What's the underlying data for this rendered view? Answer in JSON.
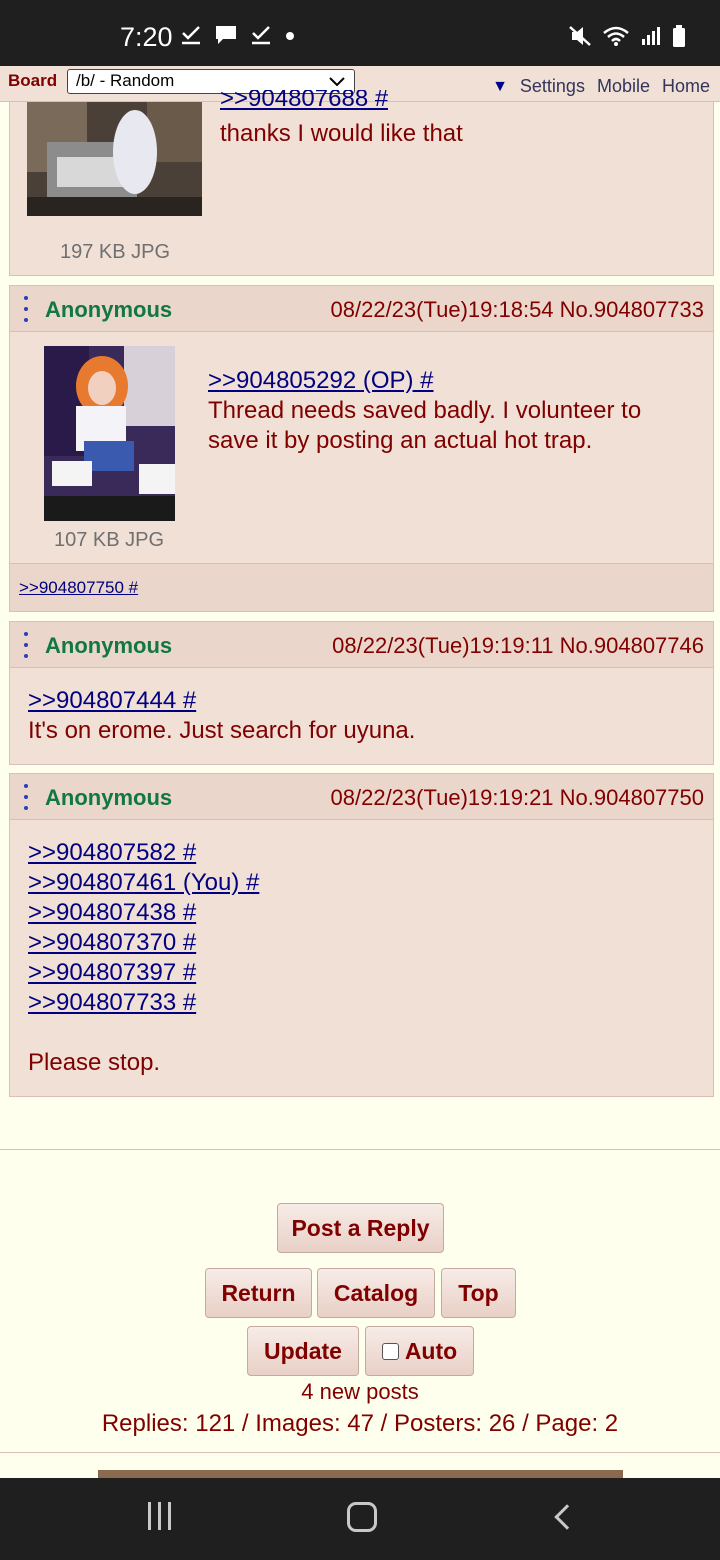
{
  "status_bar": {
    "time": "7:20",
    "left_icons": [
      "download-check-icon",
      "chat-bubble-icon",
      "check-icon",
      "dot-icon"
    ],
    "right_icons": [
      "mute-icon",
      "wifi-icon",
      "signal-icon",
      "battery-icon"
    ]
  },
  "board_bar": {
    "board_label": "Board",
    "board_value": "/b/ - Random",
    "settings": "Settings",
    "mobile": "Mobile",
    "home": "Home"
  },
  "posts": [
    {
      "partial": true,
      "quote": ">>904807688 #",
      "text": "thanks I would like that",
      "file_info": "197 KB JPG"
    },
    {
      "name": "Anonymous",
      "date_no": "08/22/23(Tue)19:18:54 No.904807733",
      "quotes": [
        ">>904805292 (OP) #"
      ],
      "text_lines": [
        "Thread needs saved badly. I volunteer to",
        "save it by posting an actual hot trap."
      ],
      "file_info": "107 KB JPG",
      "backlink": ">>904807750 #"
    },
    {
      "name": "Anonymous",
      "date_no": "08/22/23(Tue)19:19:11 No.904807746",
      "quotes": [
        ">>904807444 #"
      ],
      "text": "It's on erome. Just search for uyuna."
    },
    {
      "name": "Anonymous",
      "date_no": "08/22/23(Tue)19:19:21 No.904807750",
      "quotes": [
        ">>904807582 #",
        ">>904807461 (You) #",
        ">>904807438 #",
        ">>904807370 #",
        ">>904807397 #",
        ">>904807733 #"
      ],
      "text": "Please stop."
    }
  ],
  "controls": {
    "post_reply": "Post a Reply",
    "return": "Return",
    "catalog": "Catalog",
    "top": "Top",
    "update": "Update",
    "auto": "Auto",
    "new_posts": "4 new posts",
    "stats": "Replies: 121 / Images: 47 / Posters: 26 / Page: 2"
  },
  "colors": {
    "post_bg": "#f0e0d6",
    "name": "#117743",
    "text": "#800000",
    "link": "#000080",
    "page_bg": "#ffffee"
  }
}
